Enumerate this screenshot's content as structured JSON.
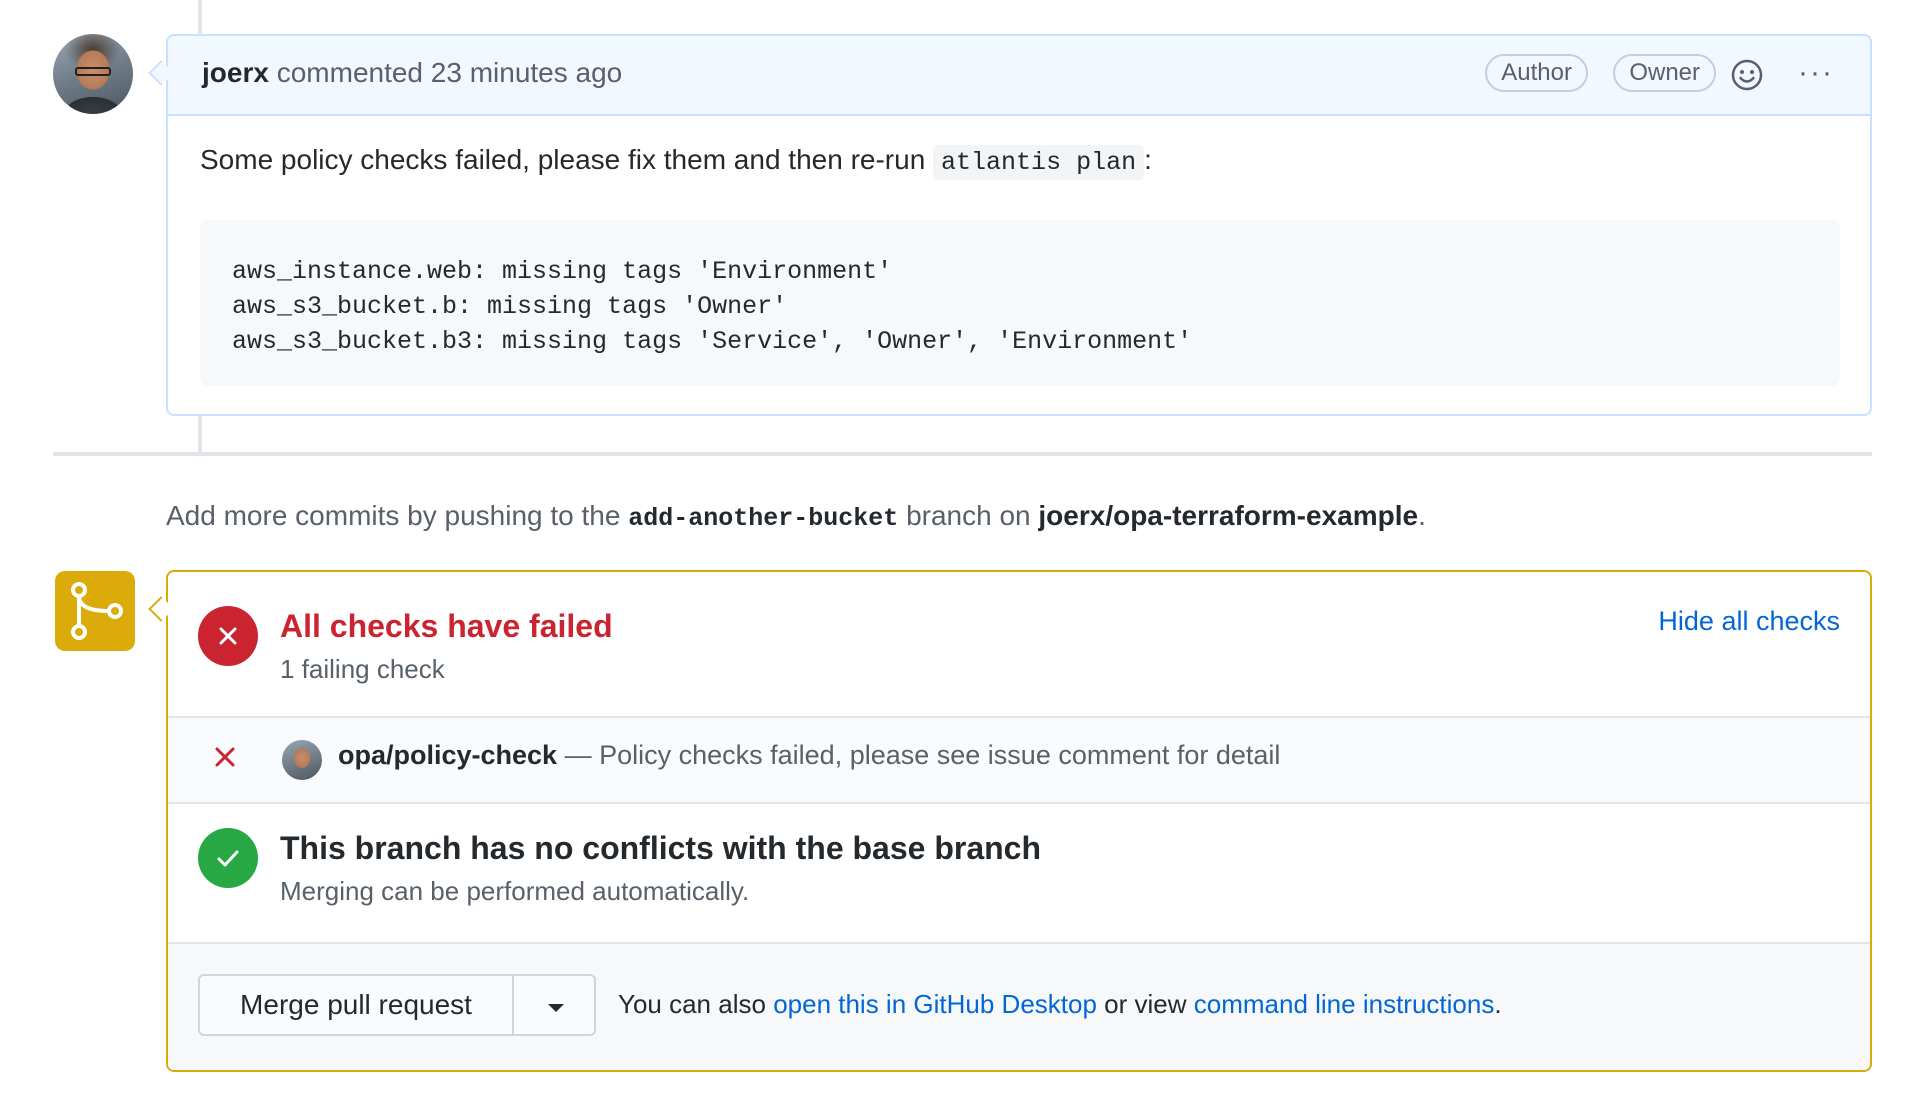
{
  "comment": {
    "author": "joerx",
    "action": "commented 23 minutes ago",
    "badges": [
      "Author",
      "Owner"
    ],
    "more_label": "···",
    "body_prefix": "Some policy checks failed, please fix them and then re-run",
    "body_code": "atlantis plan",
    "body_suffix": ":",
    "code_lines": [
      "aws_instance.web: missing tags 'Environment'",
      "aws_s3_bucket.b: missing tags 'Owner'",
      "aws_s3_bucket.b3: missing tags 'Service', 'Owner', 'Environment'"
    ]
  },
  "push_hint": {
    "prefix": "Add more commits by pushing to the",
    "branch": "add-another-bucket",
    "middle": "branch on",
    "repo": "joerx/opa-terraform-example",
    "suffix": "."
  },
  "checks": {
    "title": "All checks have failed",
    "subtitle": "1 failing check",
    "hide_label": "Hide all checks",
    "items": [
      {
        "name": "opa/policy-check",
        "description": "— Policy checks failed, please see issue comment for detail",
        "status": "failed"
      }
    ]
  },
  "conflicts": {
    "title": "This branch has no conflicts with the base branch",
    "subtitle": "Merging can be performed automatically."
  },
  "merge": {
    "button_label": "Merge pull request",
    "footer_prefix": "You can also",
    "desktop_link": "open this in GitHub Desktop",
    "footer_middle": "or view",
    "cli_link": "command line instructions",
    "footer_suffix": "."
  },
  "colors": {
    "fail": "#cb2431",
    "success": "#28a745",
    "link": "#0366d6",
    "merge_accent": "#dbab09",
    "comment_border": "#c8e1ff"
  }
}
